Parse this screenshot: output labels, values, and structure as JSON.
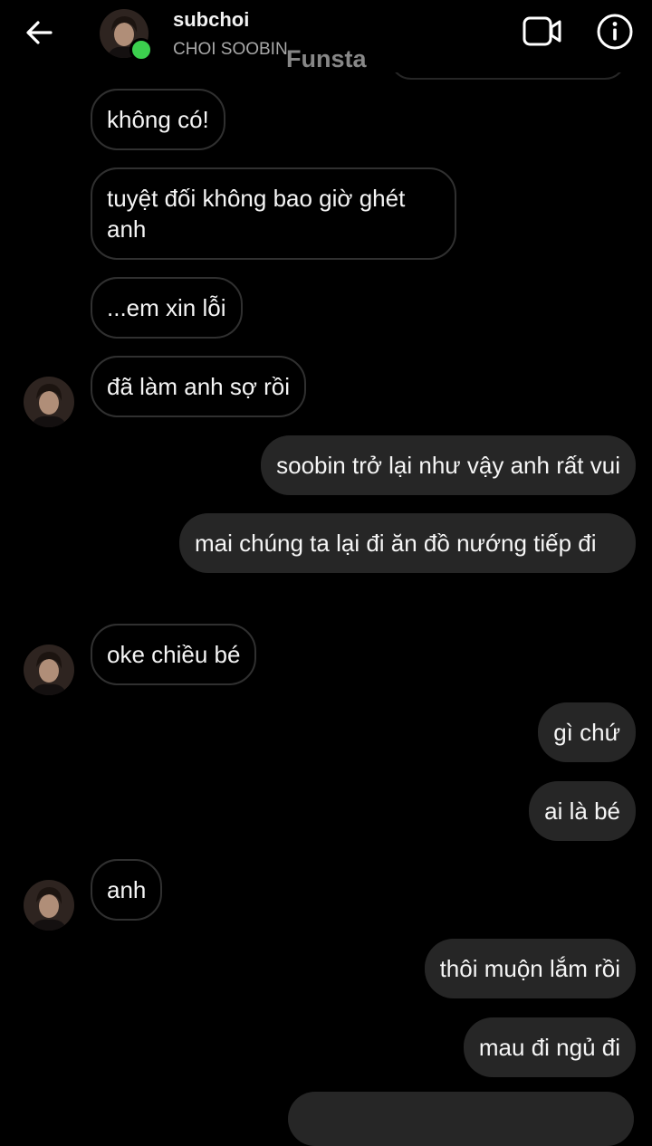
{
  "header": {
    "username": "subchoi",
    "full_name": "CHOI SOOBIN",
    "watermark": "Funsta",
    "back_icon": "arrow-left-icon",
    "video_icon": "video-camera-icon",
    "info_icon": "info-icon",
    "online_status_color": "#3ccf4e"
  },
  "messages": [
    {
      "id": "m1",
      "direction": "in",
      "text": "không có!"
    },
    {
      "id": "m2",
      "direction": "in",
      "text": "tuyệt đối không bao giờ ghét anh"
    },
    {
      "id": "m3",
      "direction": "in",
      "text": "...em xin lỗi"
    },
    {
      "id": "m4",
      "direction": "in",
      "text": "đã làm anh sợ rồi"
    },
    {
      "id": "m5",
      "direction": "out",
      "text": "soobin trở lại như vậy anh rất vui"
    },
    {
      "id": "m6",
      "direction": "out",
      "text": "mai chúng ta lại đi ăn đồ nướng tiếp đi"
    },
    {
      "id": "m7",
      "direction": "in",
      "text": "oke chiều bé"
    },
    {
      "id": "m8",
      "direction": "out",
      "text": "gì chứ"
    },
    {
      "id": "m9",
      "direction": "out",
      "text": "ai là bé"
    },
    {
      "id": "m10",
      "direction": "in",
      "text": "anh"
    },
    {
      "id": "m11",
      "direction": "out",
      "text": "thôi muộn lắm rồi"
    },
    {
      "id": "m12",
      "direction": "out",
      "text": "mau đi ngủ đi"
    }
  ],
  "colors": {
    "background": "#000000",
    "outgoing_bubble": "#262626",
    "incoming_border": "#303030",
    "text": "#f5f5f5",
    "secondary_text": "#a8a8a8"
  }
}
